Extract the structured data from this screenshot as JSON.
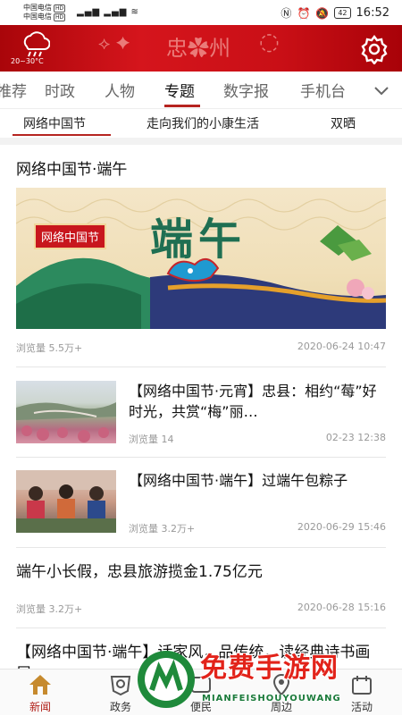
{
  "status": {
    "carrier_line1": "中国电信",
    "carrier_line2": "中国电信",
    "hd": "HD",
    "battery": "42",
    "time": "16:52"
  },
  "header": {
    "weather_temp": "20~30°C",
    "banner_colors": [
      "#a9050a",
      "#d5151c"
    ]
  },
  "tabs": {
    "items": [
      {
        "label": "推荐"
      },
      {
        "label": "时政"
      },
      {
        "label": "人物"
      },
      {
        "label": "专题"
      },
      {
        "label": "数字报"
      },
      {
        "label": "手机台"
      }
    ],
    "active_index": 3,
    "accent": "#b62420"
  },
  "subtabs": {
    "items": [
      {
        "label": "网络中国节"
      },
      {
        "label": "走向我们的小康生活"
      },
      {
        "label": "双晒"
      }
    ],
    "active_index": 0
  },
  "feed": {
    "items": [
      {
        "title": "网络中国节·端午",
        "views": "浏览量 5.5万+",
        "date": "2020-06-24 10:47",
        "hero_tag": "网络中国节",
        "hero_big": "端午"
      },
      {
        "title": "【网络中国节·元宵】忠县：相约“莓”好时光，共赏“梅”丽…",
        "views": "浏览量 14",
        "date": "02-23 12:38"
      },
      {
        "title": "【网络中国节·端午】过端午包粽子",
        "views": "浏览量 3.2万+",
        "date": "2020-06-29 15:46"
      },
      {
        "title": "端午小长假，忠县旅游揽金1.75亿元",
        "views": "浏览量 3.2万+",
        "date": "2020-06-28 15:16"
      },
      {
        "title": "【网络中国节·端午】话家风，品传统，读经典诗书画展…",
        "views": "",
        "date": ""
      }
    ]
  },
  "bottom_nav": {
    "items": [
      {
        "label": "新闻",
        "icon": "home-icon"
      },
      {
        "label": "政务",
        "icon": "government-icon"
      },
      {
        "label": "便民",
        "icon": "service-icon"
      },
      {
        "label": "周边",
        "icon": "nearby-icon"
      },
      {
        "label": "活动",
        "icon": "activity-icon"
      }
    ],
    "active_index": 0
  },
  "watermark": {
    "text": "免费手游网",
    "sub": "MIANFEISHOUYOUWANG"
  }
}
